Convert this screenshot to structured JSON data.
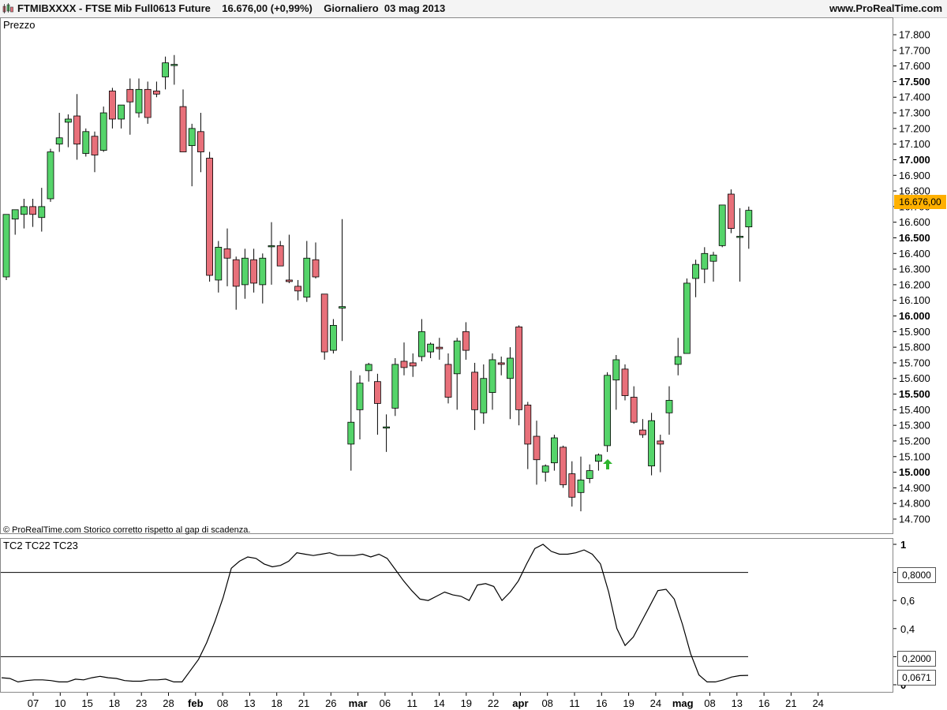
{
  "header": {
    "symbol": "FTMIBXXXX",
    "title": "FTMIBXXXX - FTSE Mib Full0613 Future    16.676,00 (+0,99%)    Giornaliero  03 mag 2013",
    "brand": "www.ProRealTime.com"
  },
  "price_panel": {
    "label": "Prezzo",
    "copyright": "© ProRealTime.com  Storico corretto rispetto al gap di scadenza.",
    "last_price_tag": "16.676,00"
  },
  "indicator_panel": {
    "label": "TC2 TC22 TC23",
    "level_high_tag": "0,8000",
    "level_low_tag": "0,2000",
    "current_tag": "0,0671"
  },
  "colors": {
    "up": "#55d46a",
    "down": "#e8707a",
    "price_tag": "#ffb000",
    "arrow": "#2db52d"
  },
  "chart_data": [
    {
      "type": "candlestick",
      "title": "",
      "ylabel": "Prezzo",
      "ylim": [
        14650,
        17800
      ],
      "yticks": [
        14700,
        14800,
        14900,
        15000,
        15100,
        15200,
        15300,
        15400,
        15500,
        15600,
        15700,
        15800,
        15900,
        16000,
        16100,
        16200,
        16300,
        16400,
        16500,
        16600,
        16700,
        16800,
        16900,
        17000,
        17100,
        17200,
        17300,
        17400,
        17500,
        17600,
        17700,
        17800
      ],
      "ytick_labels": [
        "14.700",
        "14.800",
        "14.900",
        "15.000",
        "15.100",
        "15.200",
        "15.300",
        "15.400",
        "15.500",
        "15.600",
        "15.700",
        "15.800",
        "15.900",
        "16.000",
        "16.100",
        "16.200",
        "16.300",
        "16.400",
        "16.500",
        "16.600",
        "16.700",
        "16.800",
        "16.900",
        "17.000",
        "17.100",
        "17.200",
        "17.300",
        "17.400",
        "17.500",
        "17.600",
        "17.700",
        "17.800"
      ],
      "bold_ticks": [
        15000,
        15500,
        16000,
        16500,
        17000,
        17500
      ],
      "xtick_labels": [
        "07",
        "10",
        "15",
        "18",
        "23",
        "28",
        "feb",
        "08",
        "13",
        "18",
        "21",
        "26",
        "mar",
        "06",
        "11",
        "14",
        "19",
        "22",
        "apr",
        "08",
        "11",
        "16",
        "19",
        "24",
        "mag",
        "08",
        "13",
        "16",
        "21",
        "24"
      ],
      "bold_xticks": [
        "feb",
        "mar",
        "apr",
        "mag"
      ],
      "candles": [
        [
          16250,
          16650,
          16230,
          16650
        ],
        [
          16620,
          16680,
          16520,
          16680
        ],
        [
          16650,
          16750,
          16560,
          16700
        ],
        [
          16700,
          16750,
          16570,
          16650
        ],
        [
          16630,
          16820,
          16540,
          16700
        ],
        [
          16750,
          17070,
          16730,
          17050
        ],
        [
          17100,
          17300,
          17050,
          17140
        ],
        [
          17240,
          17290,
          17080,
          17260
        ],
        [
          17280,
          17420,
          17000,
          17100
        ],
        [
          17040,
          17200,
          17020,
          17180
        ],
        [
          17150,
          17180,
          16920,
          17030
        ],
        [
          17060,
          17340,
          17050,
          17300
        ],
        [
          17440,
          17460,
          17200,
          17260
        ],
        [
          17260,
          17350,
          17200,
          17350
        ],
        [
          17450,
          17520,
          17160,
          17370
        ],
        [
          17300,
          17520,
          17270,
          17450
        ],
        [
          17450,
          17500,
          17230,
          17270
        ],
        [
          17440,
          17500,
          17400,
          17420
        ],
        [
          17530,
          17660,
          17450,
          17620
        ],
        [
          17610,
          17670,
          17480,
          17610
        ],
        [
          17340,
          17450,
          17050,
          17050
        ],
        [
          17090,
          17230,
          16830,
          17200
        ],
        [
          17180,
          17300,
          16920,
          17050
        ],
        [
          17010,
          17050,
          16220,
          16260
        ],
        [
          16230,
          16480,
          16150,
          16440
        ],
        [
          16430,
          16560,
          16190,
          16370
        ],
        [
          16360,
          16380,
          16040,
          16190
        ],
        [
          16200,
          16430,
          16110,
          16370
        ],
        [
          16360,
          16430,
          16150,
          16210
        ],
        [
          16200,
          16400,
          16080,
          16370
        ],
        [
          16450,
          16600,
          16200,
          16450
        ],
        [
          16450,
          16480,
          16320,
          16320
        ],
        [
          16230,
          16520,
          16210,
          16220
        ],
        [
          16190,
          16230,
          16100,
          16160
        ],
        [
          16120,
          16480,
          16090,
          16370
        ],
        [
          16360,
          16470,
          16240,
          16250
        ],
        [
          16140,
          16140,
          15720,
          15770
        ],
        [
          15780,
          15980,
          15760,
          15940
        ],
        [
          16050,
          16620,
          15840,
          16060
        ],
        [
          15180,
          15650,
          15010,
          15320
        ],
        [
          15400,
          15620,
          15210,
          15570
        ],
        [
          15650,
          15700,
          15580,
          15690
        ],
        [
          15580,
          15630,
          15240,
          15440
        ],
        [
          15290,
          15370,
          15130,
          15290
        ],
        [
          15410,
          15730,
          15360,
          15690
        ],
        [
          15710,
          15830,
          15620,
          15670
        ],
        [
          15700,
          15760,
          15610,
          15680
        ],
        [
          15740,
          15980,
          15710,
          15900
        ],
        [
          15770,
          15830,
          15730,
          15820
        ],
        [
          15800,
          15860,
          15720,
          15790
        ],
        [
          15690,
          15760,
          15440,
          15480
        ],
        [
          15630,
          15860,
          15400,
          15840
        ],
        [
          15900,
          15960,
          15720,
          15780
        ],
        [
          15640,
          15700,
          15270,
          15400
        ],
        [
          15380,
          15690,
          15310,
          15600
        ],
        [
          15510,
          15760,
          15400,
          15720
        ],
        [
          15700,
          15740,
          15620,
          15690
        ],
        [
          15600,
          15800,
          15340,
          15730
        ],
        [
          15930,
          15940,
          15300,
          15400
        ],
        [
          15430,
          15450,
          15020,
          15180
        ],
        [
          15230,
          15330,
          14920,
          15080
        ],
        [
          15000,
          15050,
          14940,
          15040
        ],
        [
          15060,
          15240,
          15010,
          15220
        ],
        [
          15160,
          15170,
          14900,
          14920
        ],
        [
          14990,
          15070,
          14780,
          14840
        ],
        [
          14870,
          15100,
          14750,
          14950
        ],
        [
          14960,
          15050,
          14930,
          15010
        ],
        [
          15070,
          15120,
          15010,
          15110
        ],
        [
          15170,
          15640,
          15130,
          15620
        ],
        [
          15590,
          15750,
          15400,
          15720
        ],
        [
          15660,
          15690,
          15460,
          15490
        ],
        [
          15480,
          15550,
          15310,
          15320
        ],
        [
          15270,
          15340,
          15220,
          15240
        ],
        [
          15040,
          15380,
          14980,
          15330
        ],
        [
          15200,
          15240,
          15000,
          15180
        ],
        [
          15380,
          15550,
          15240,
          15460
        ],
        [
          15690,
          15860,
          15620,
          15740
        ],
        [
          15760,
          16240,
          15760,
          16210
        ],
        [
          16240,
          16360,
          16120,
          16330
        ],
        [
          16300,
          16440,
          16210,
          16400
        ],
        [
          16350,
          16410,
          16220,
          16390
        ],
        [
          16450,
          16710,
          16440,
          16710
        ],
        [
          16780,
          16810,
          16530,
          16560
        ],
        [
          16510,
          16690,
          16220,
          16510
        ],
        [
          16570,
          16700,
          16430,
          16676
        ]
      ],
      "signal_arrow": "up"
    },
    {
      "type": "line",
      "series": [
        {
          "name": "",
          "values": [
            0.05,
            0.045,
            0.02,
            0.03,
            0.035,
            0.035,
            0.03,
            0.02,
            0.02,
            0.04,
            0.035,
            0.05,
            0.06,
            0.05,
            0.045,
            0.03,
            0.025,
            0.025,
            0.035,
            0.035,
            0.04,
            0.02,
            0.02,
            0.1,
            0.18,
            0.3,
            0.45,
            0.62,
            0.83,
            0.88,
            0.91,
            0.9,
            0.86,
            0.84,
            0.85,
            0.88,
            0.94,
            0.93,
            0.92,
            0.93,
            0.94,
            0.92,
            0.92,
            0.92,
            0.93,
            0.91,
            0.93,
            0.9,
            0.82,
            0.74,
            0.67,
            0.61,
            0.6,
            0.63,
            0.66,
            0.64,
            0.63,
            0.6,
            0.71,
            0.72,
            0.7,
            0.6,
            0.66,
            0.74,
            0.86,
            0.97,
            1.0,
            0.95,
            0.93,
            0.93,
            0.94,
            0.96,
            0.93,
            0.86,
            0.66,
            0.4,
            0.28,
            0.34,
            0.45,
            0.56,
            0.67,
            0.68,
            0.61,
            0.43,
            0.22,
            0.07,
            0.02,
            0.02,
            0.035,
            0.055,
            0.065,
            0.067
          ]
        }
      ],
      "ylim": [
        0,
        1
      ],
      "ytick_labels": [
        "0",
        "0,2",
        "0,4",
        "0,6",
        "0,8",
        "1"
      ],
      "levels": [
        0.8,
        0.2
      ]
    }
  ]
}
